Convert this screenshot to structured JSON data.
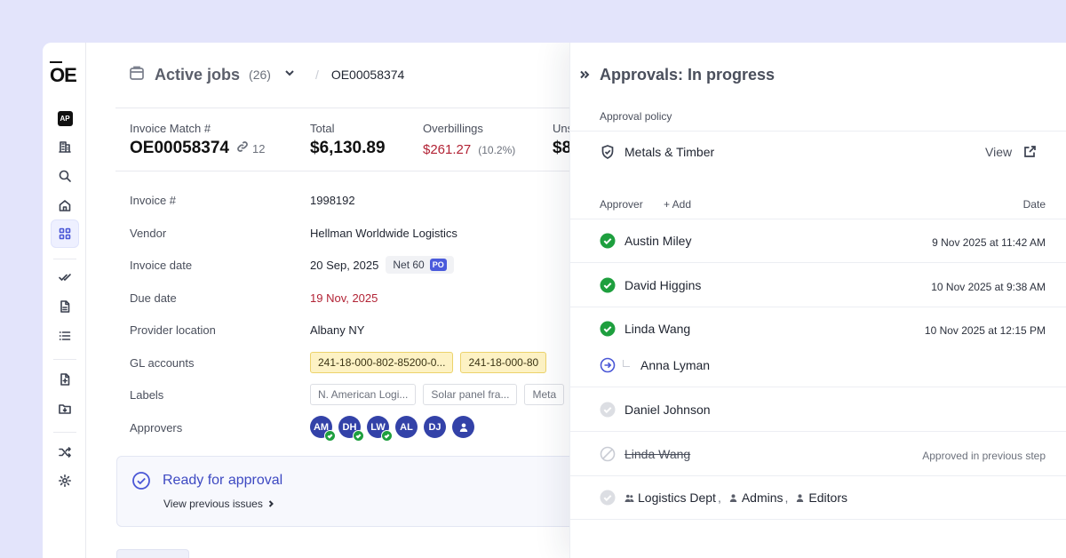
{
  "sidebar": {
    "logo": "OE",
    "ap_badge": "AP"
  },
  "header": {
    "title": "Active jobs",
    "count": "(26)",
    "separator": "/",
    "crumb": "OE00058374"
  },
  "summary": {
    "invoice_match_label": "Invoice Match #",
    "invoice_match_value": "OE00058374",
    "linked_count": "12",
    "total_label": "Total",
    "total_value": "$6,130.89",
    "overbillings_label": "Overbillings",
    "overbillings_value": "$261.27",
    "overbillings_pct": "(10.2%)",
    "cut_label": "Uns",
    "cut_value": "$8"
  },
  "details": {
    "invoice_no_label": "Invoice #",
    "invoice_no": "1998192",
    "vendor_label": "Vendor",
    "vendor": "Hellman Worldwide Logistics",
    "invoice_date_label": "Invoice date",
    "invoice_date": "20 Sep, 2025",
    "terms": "Net 60",
    "po_badge": "PO",
    "due_date_label": "Due date",
    "due_date": "19 Nov, 2025",
    "provider_location_label": "Provider location",
    "provider_location": "Albany NY",
    "gl_accounts_label": "GL accounts",
    "gl_accounts": [
      "241-18-000-802-85200-0...",
      "241-18-000-80"
    ],
    "labels_label": "Labels",
    "labels": [
      "N. American Logi...",
      "Solar panel fra...",
      "Meta"
    ],
    "approvers_label": "Approvers",
    "approvers": [
      {
        "initials": "AM",
        "approved": true
      },
      {
        "initials": "DH",
        "approved": true
      },
      {
        "initials": "LW",
        "approved": true
      },
      {
        "initials": "AL",
        "approved": false
      },
      {
        "initials": "DJ",
        "approved": false
      },
      {
        "initials": "",
        "icon": "person-icon",
        "approved": false
      }
    ]
  },
  "ready": {
    "title": "Ready for approval",
    "link": "View previous issues"
  },
  "panel": {
    "title": "Approvals: In progress",
    "policy_label": "Approval policy",
    "policy_name": "Metals & Timber",
    "view_label": "View",
    "approver_header": "Approver",
    "add_label": "+ Add",
    "date_header": "Date",
    "rows": [
      {
        "name": "Austin Miley",
        "date": "9 Nov 2025 at 11:42 AM",
        "status": "approved"
      },
      {
        "name": "David Higgins",
        "date": "10 Nov 2025 at 9:38 AM",
        "status": "approved"
      },
      {
        "name": "Linda Wang",
        "date": "10 Nov 2025 at 12:15 PM",
        "status": "approved"
      },
      {
        "name": "Anna Lyman",
        "date": "",
        "status": "forwarded"
      },
      {
        "name": "Daniel Johnson",
        "date": "",
        "status": "pending"
      },
      {
        "name": "Linda Wang",
        "date": "Approved in previous step",
        "status": "skipped"
      }
    ],
    "groups": [
      "Logistics Dept",
      "Admins",
      "Editors"
    ]
  },
  "colors": {
    "accent": "#4a57d6",
    "approved_green": "#1e9f3e",
    "danger_red": "#b22335",
    "avatar_blue": "#3342a8",
    "gl_yellow": "#fdf2c4"
  }
}
